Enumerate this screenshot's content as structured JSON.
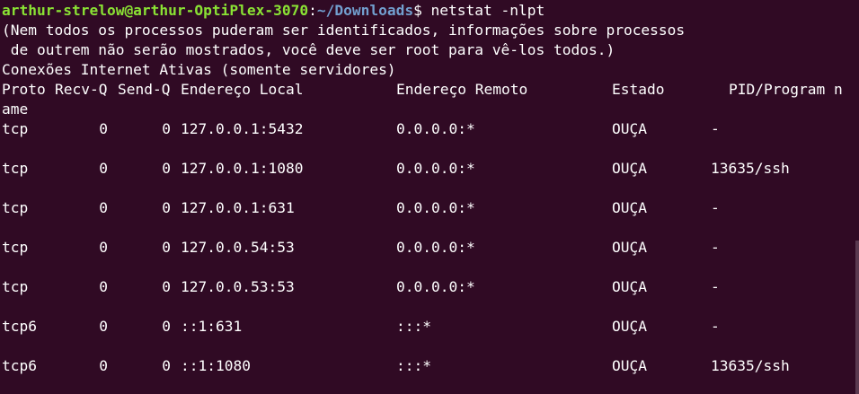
{
  "terminal": {
    "colors": {
      "background": "#300a24",
      "foreground": "#ffffff",
      "user": "#8ae234",
      "path": "#729fcf"
    },
    "prompt": {
      "user_host": "arthur-strelow@arthur-OptiPlex-3070",
      "separator": ":",
      "path": "~/Downloads",
      "symbol": "$",
      "command": " netstat -nlpt"
    },
    "notice_lines": [
      "(Nem todos os processos puderam ser identificados, informações sobre processos",
      " de outrem não serão mostrados, você deve ser root para vê-los todos.)",
      "Conexões Internet Ativas (somente servidores)"
    ],
    "headers": {
      "proto": "Proto",
      "recvq": "Recv-Q",
      "sendq": "Send-Q",
      "local": "Endereço Local",
      "remote": "Endereço Remoto",
      "state": "Estado",
      "pid": "PID/Program n",
      "pid_wrap": "ame"
    },
    "rows": [
      {
        "proto": "tcp",
        "recvq": "0",
        "sendq": "0",
        "local": "127.0.0.1:5432",
        "remote": "0.0.0.0:*",
        "state": "OUÇA",
        "pid": "-"
      },
      {
        "proto": "tcp",
        "recvq": "0",
        "sendq": "0",
        "local": "127.0.0.1:1080",
        "remote": "0.0.0.0:*",
        "state": "OUÇA",
        "pid": "13635/ssh"
      },
      {
        "proto": "tcp",
        "recvq": "0",
        "sendq": "0",
        "local": "127.0.0.1:631",
        "remote": "0.0.0.0:*",
        "state": "OUÇA",
        "pid": "-"
      },
      {
        "proto": "tcp",
        "recvq": "0",
        "sendq": "0",
        "local": "127.0.0.54:53",
        "remote": "0.0.0.0:*",
        "state": "OUÇA",
        "pid": "-"
      },
      {
        "proto": "tcp",
        "recvq": "0",
        "sendq": "0",
        "local": "127.0.0.53:53",
        "remote": "0.0.0.0:*",
        "state": "OUÇA",
        "pid": "-"
      },
      {
        "proto": "tcp6",
        "recvq": "0",
        "sendq": "0",
        "local": "::1:631",
        "remote": ":::*",
        "state": "OUÇA",
        "pid": "-"
      },
      {
        "proto": "tcp6",
        "recvq": "0",
        "sendq": "0",
        "local": "::1:1080",
        "remote": ":::*",
        "state": "OUÇA",
        "pid": "13635/ssh"
      }
    ]
  }
}
